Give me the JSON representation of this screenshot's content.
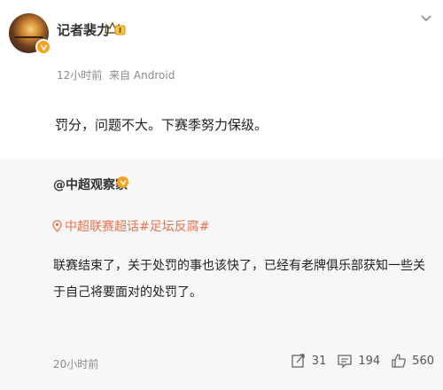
{
  "post": {
    "username": "记者裴力",
    "time": "12小时前",
    "source": "来自 Android",
    "content": "罚分，问题不大。下赛季努力保级。",
    "icons": {
      "avatar": "avatar",
      "verified": "verified-v-icon",
      "crown": "crown-badge-icon",
      "menu": "chevron-down-icon"
    }
  },
  "repost": {
    "username": "@中超观察家",
    "topic": "中超联赛超话#足坛反腐#",
    "text": "联赛结束了，关于处罚的事也该快了，已经有老牌俱乐部获知一些关于自己将要面对的处罚了。",
    "time": "20小时前",
    "stats": {
      "reposts": "31",
      "comments": "194",
      "likes": "560"
    }
  },
  "colors": {
    "accent_orange": "#eb7350",
    "badge_orange": "#f7a21b",
    "bg_gray": "#f7f7f7"
  }
}
